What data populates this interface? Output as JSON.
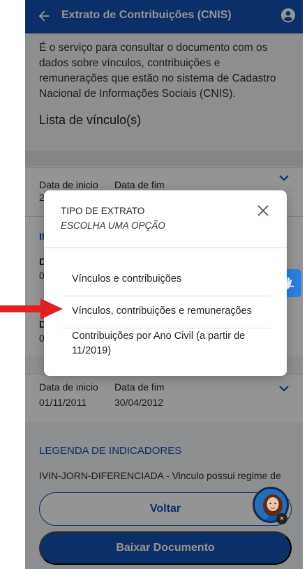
{
  "header": {
    "title": "Extrato de Contribuições (CNIS)",
    "back_icon": "arrow-left-icon",
    "user_icon": "user-circle-icon"
  },
  "main": {
    "description": "É o serviço para consultar o documento com os dados sobre vínculos, contribuições e remunerações que estão no sistema de Cadastro Nacional de Informações Sociais (CNIS).",
    "list_title": "Lista de vínculo(s)",
    "cards": [
      {
        "start_label": "Data de inicio",
        "end_label": "Data de fim",
        "start_value": "2",
        "end_value": ""
      },
      {
        "start_label": "Data de inicio",
        "end_label": "Data de fim",
        "start_value": "01/11/2011",
        "end_value": "30/04/2012"
      }
    ],
    "partial_labels": [
      "IN",
      "Da",
      "0",
      "Da",
      "0"
    ],
    "legend_title": "LEGENDA DE INDICADORES",
    "legend_text": "IVIN-JORN-DIFERENCIADA - Vinculo possui regime de"
  },
  "buttons": {
    "voltar": "Voltar",
    "baixar": "Baixar Documento"
  },
  "modal": {
    "title": "TIPO DE EXTRATO",
    "subtitle": "ESCOLHA UMA OPÇÃO",
    "close_icon": "close-icon",
    "options": [
      "Vínculos e contribuições",
      "Vínculos, contribuições e remunerações",
      "Contribuições por Ano Civil (a partir de 11/2019)"
    ]
  },
  "colors": {
    "primary": "#1351b4",
    "annotation_arrow": "#e02020",
    "accessibility": "#2b7fe0"
  },
  "icons": {
    "accessibility": "hand-sign-icon",
    "assistant": "assistant-avatar-icon"
  }
}
